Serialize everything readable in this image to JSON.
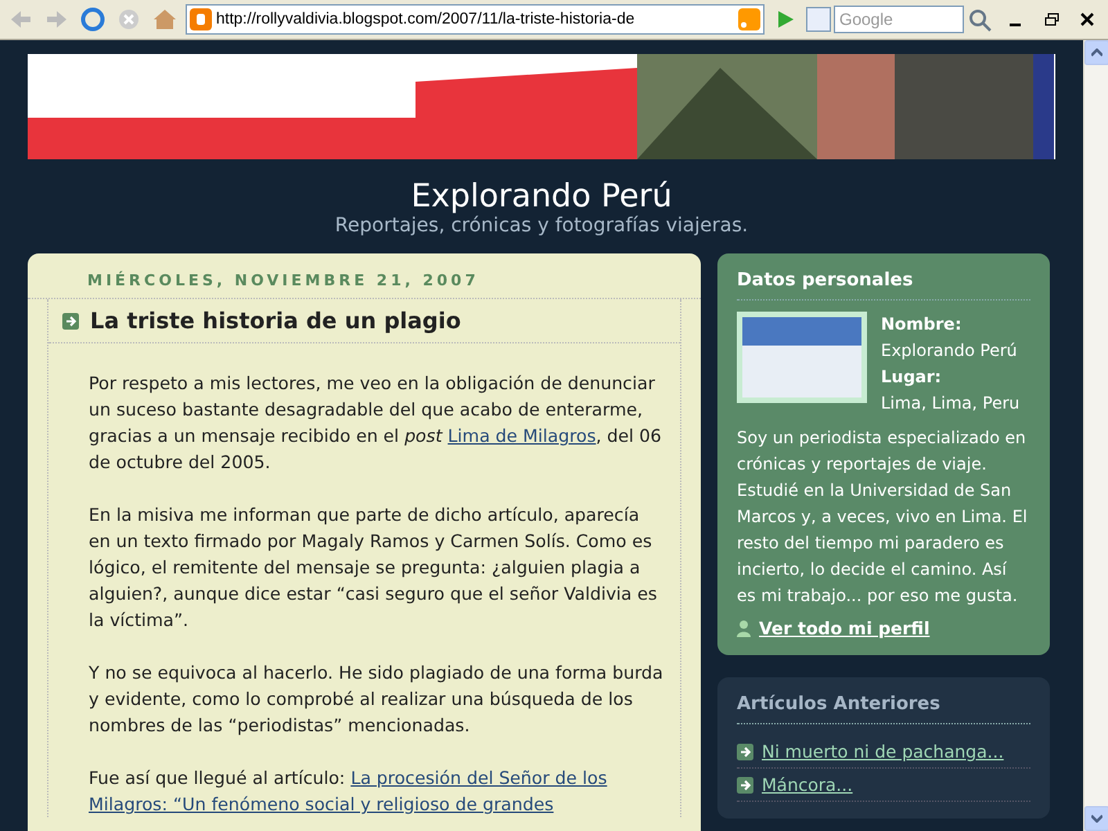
{
  "browser": {
    "url": "http://rollyvaldivia.blogspot.com/2007/11/la-triste-historia-de",
    "search": {
      "placeholder": "Google"
    }
  },
  "blog": {
    "title": "Explorando Perú",
    "description": "Reportajes, crónicas y fotografías viajeras."
  },
  "post": {
    "date": "MIÉRCOLES, NOVIEMBRE 21, 2007",
    "title": "La triste historia de un plagio",
    "paragraphs": [
      [
        {
          "kind": "text",
          "text": "Por respeto a mis lectores, me veo en la obligación de denunciar un suceso bastante desagradable del que acabo de enterarme, gracias a un mensaje recibido en el *post* "
        },
        {
          "kind": "link",
          "text": "Lima de Milagros"
        },
        {
          "kind": "text",
          "text": ", del 06 de octubre del 2005."
        }
      ],
      [
        {
          "kind": "text",
          "text": "En la misiva me informan que parte de dicho artículo, aparecía en un texto firmado por Magaly Ramos y Carmen Solís. Como es lógico, el remitente del mensaje se pregunta: ¿alguien plagia a alguien?, aunque dice estar “casi seguro que el señor Valdivia es la víctima”."
        }
      ],
      [
        {
          "kind": "text",
          "text": "Y no se equivoca al hacerlo. He sido plagiado de una forma burda y evidente, como lo comprobé al realizar una búsqueda de los nombres de las “periodistas” mencionadas."
        }
      ],
      [
        {
          "kind": "text",
          "text": "Fue así que llegué al artículo: "
        },
        {
          "kind": "link",
          "text": "La procesión del Señor de los "
        },
        {
          "kind": "link",
          "text": "Milagros: “Un fenómeno social y religioso de grandes"
        }
      ]
    ]
  },
  "profile": {
    "heading": "Datos personales",
    "fields": [
      {
        "label": "Nombre:",
        "value": "Explorando Perú"
      },
      {
        "label": "Lugar:",
        "value": "Lima, Lima, Peru"
      }
    ],
    "about": "Soy un periodista especializado en crónicas y reportajes de viaje. Estudié en la Universidad de San Marcos y, a veces, vivo en Lima. El resto del tiempo mi paradero es incierto, lo decide el camino. Así es mi trabajo... por eso me gusta.",
    "link": "Ver todo mi perfil"
  },
  "archive": {
    "heading": "Artículos Anteriores",
    "items": [
      "Ni muerto ni de pachanga...",
      "Máncora..."
    ]
  }
}
